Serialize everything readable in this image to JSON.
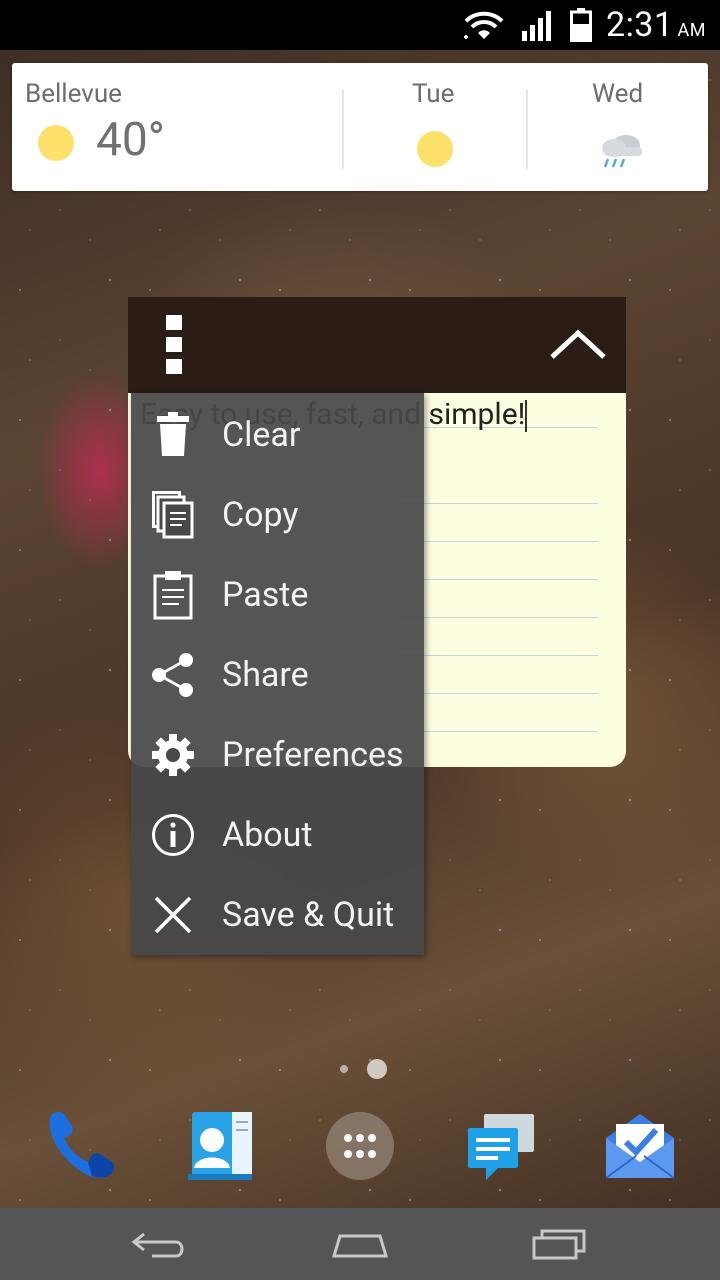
{
  "status_bar": {
    "time": "2:31",
    "ampm": "AM",
    "icons": [
      "wifi-icon",
      "signal-icon",
      "battery-icon"
    ]
  },
  "weather_widget": {
    "city": "Bellevue",
    "current_temp": "40°",
    "current_icon": "sun-icon",
    "forecast": [
      {
        "day": "Tue",
        "icon": "sun-icon"
      },
      {
        "day": "Wed",
        "icon": "rain-cloud-icon"
      }
    ]
  },
  "note_widget": {
    "text": "Easy to use, fast, and simple!",
    "menu_icon": "overflow-menu-icon",
    "collapse_icon": "chevron-up-icon",
    "background_color": "#fdfde0"
  },
  "menu": {
    "items": [
      {
        "label": "Clear",
        "icon": "trash-icon"
      },
      {
        "label": "Copy",
        "icon": "copy-icon"
      },
      {
        "label": "Paste",
        "icon": "paste-icon"
      },
      {
        "label": "Share",
        "icon": "share-icon"
      },
      {
        "label": "Preferences",
        "icon": "gear-icon"
      },
      {
        "label": "About",
        "icon": "info-icon"
      },
      {
        "label": "Save & Quit",
        "icon": "close-icon"
      }
    ]
  },
  "home_pager": {
    "pages": 2,
    "current": 2
  },
  "dock": [
    {
      "name": "Phone",
      "icon": "phone-icon"
    },
    {
      "name": "Contacts",
      "icon": "contacts-icon"
    },
    {
      "name": "Apps",
      "icon": "app-drawer-icon"
    },
    {
      "name": "Messaging",
      "icon": "messaging-icon"
    },
    {
      "name": "Inbox",
      "icon": "inbox-icon"
    }
  ],
  "nav_bar": [
    "back-icon",
    "home-icon",
    "recents-icon"
  ]
}
